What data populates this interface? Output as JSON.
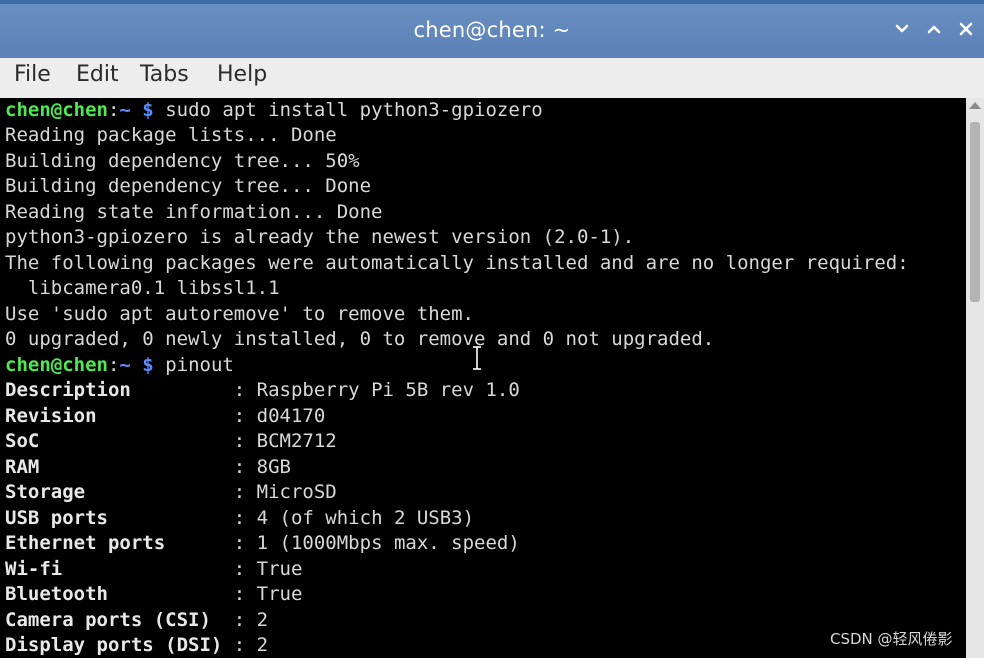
{
  "window": {
    "title": "chen@chen: ~",
    "buttons": {
      "minimize_icon": "chevron-down-icon",
      "maximize_icon": "chevron-up-icon",
      "close_icon": "close-icon"
    }
  },
  "menubar": {
    "items": [
      "File",
      "Edit",
      "Tabs",
      "Help"
    ]
  },
  "terminal": {
    "prompt": {
      "userhost": "chen@chen",
      "sep": ":",
      "path": "~",
      "symbol": " $ "
    },
    "command1": "sudo apt install python3-gpiozero",
    "apt_output": [
      "Reading package lists... Done",
      "Building dependency tree... 50%",
      "Building dependency tree... Done",
      "Reading state information... Done",
      "python3-gpiozero is already the newest version (2.0-1).",
      "The following packages were automatically installed and are no longer required:",
      "  libcamera0.1 libssl1.1",
      "Use 'sudo apt autoremove' to remove them.",
      "0 upgraded, 0 newly installed, 0 to remove and 0 not upgraded."
    ],
    "command2": "pinout",
    "pinout": [
      {
        "key": "Description        ",
        "value": ": Raspberry Pi 5B rev 1.0"
      },
      {
        "key": "Revision           ",
        "value": ": d04170"
      },
      {
        "key": "SoC                ",
        "value": ": BCM2712"
      },
      {
        "key": "RAM                ",
        "value": ": 8GB"
      },
      {
        "key": "Storage            ",
        "value": ": MicroSD"
      },
      {
        "key": "USB ports          ",
        "value": ": 4 (of which 2 USB3)"
      },
      {
        "key": "Ethernet ports     ",
        "value": ": 1 (1000Mbps max. speed)"
      },
      {
        "key": "Wi-fi              ",
        "value": ": True"
      },
      {
        "key": "Bluetooth          ",
        "value": ": True"
      },
      {
        "key": "Camera ports (CSI) ",
        "value": ": 2"
      },
      {
        "key": "Display ports (DSI)",
        "value": ": 2"
      }
    ]
  },
  "colors": {
    "titlebar": "#5a80b6",
    "terminal_bg": "#000000",
    "prompt_user": "#4fe84f",
    "prompt_path": "#5b8cff",
    "text": "#d8d8d8"
  },
  "watermark": "CSDN @轻风倦影"
}
